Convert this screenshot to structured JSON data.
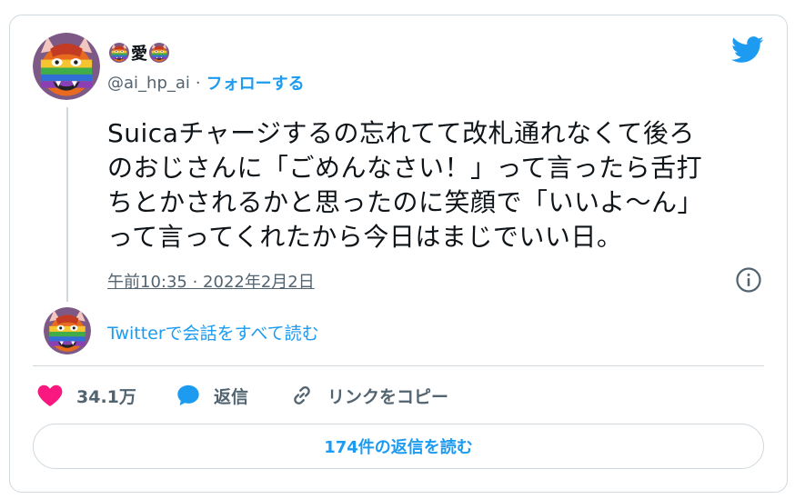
{
  "author": {
    "display_name": "愛",
    "handle": "@ai_hp_ai",
    "separator": "·",
    "follow_label": "フォローする"
  },
  "tweet": {
    "lines": [
      "Suicaチャージするの忘れてて改札通れなくて後ろ",
      "のおじさんに「ごめんなさい！」って言ったら舌打",
      "ちとかされるかと思ったのに笑顔で「いいよ〜ん」",
      "って言ってくれたから今日はまじでいい日。"
    ],
    "timestamp": "午前10:35 · 2022年2月2日"
  },
  "conversation": {
    "link_label": "Twitterで会話をすべて読む"
  },
  "actions": {
    "like_count": "34.1万",
    "reply_label": "返信",
    "copy_link_label": "リンクをコピー"
  },
  "footer": {
    "read_replies_label": "174件の返信を読む"
  },
  "colors": {
    "accent": "#1d9bf0",
    "like": "#f91880",
    "secondary_text": "#536471",
    "border": "#cfd9de"
  },
  "icons": {
    "brand": "twitter-bird-icon",
    "avatar": "oni-avatar",
    "like": "heart-icon",
    "reply": "speech-bubble-icon",
    "copy": "link-icon",
    "info": "info-icon"
  }
}
